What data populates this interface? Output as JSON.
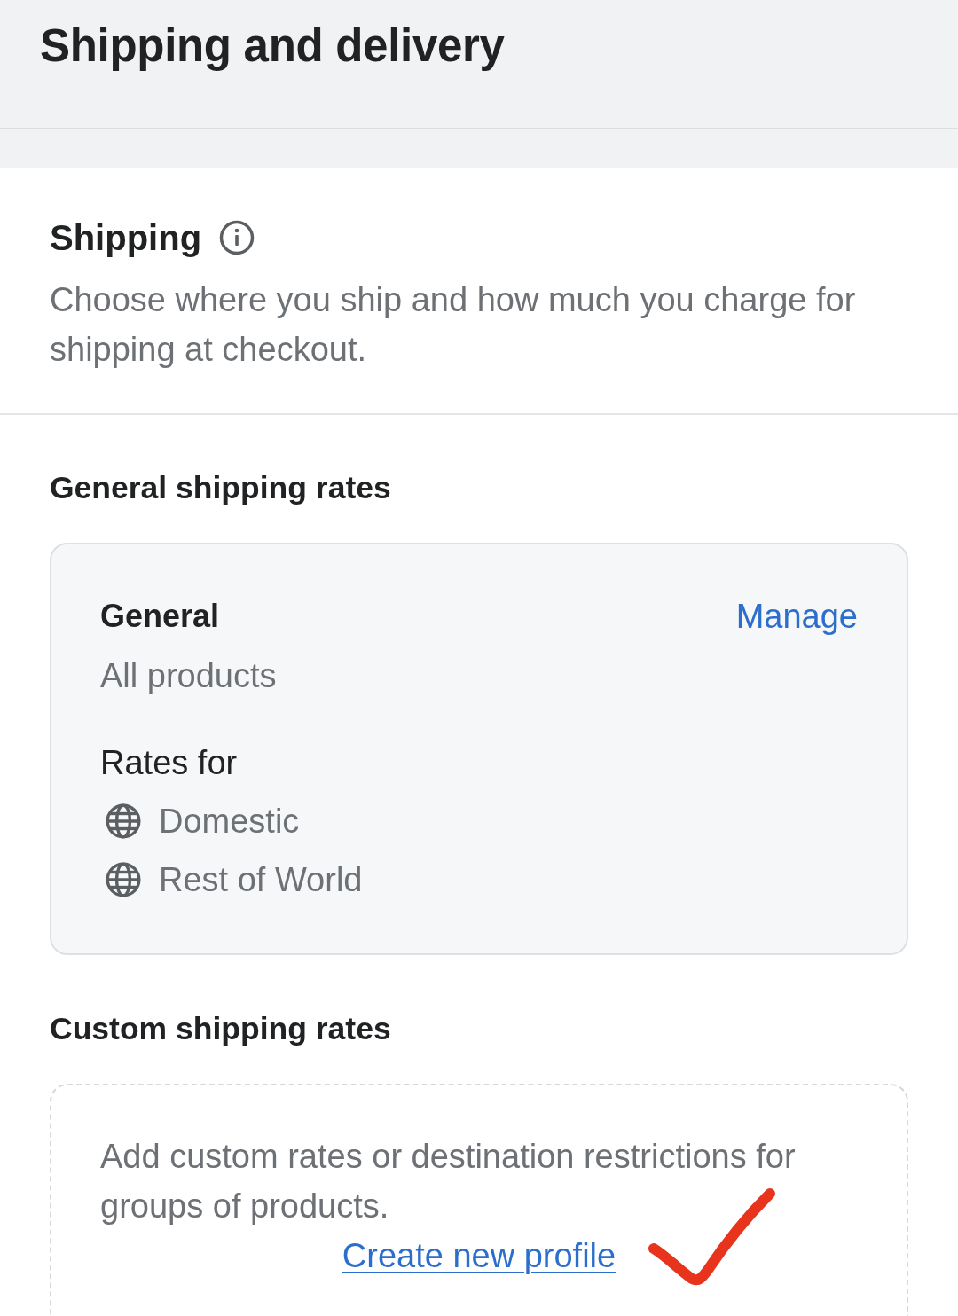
{
  "header": {
    "title": "Shipping and delivery"
  },
  "shipping": {
    "title": "Shipping",
    "description": "Choose where you ship and how much you charge for shipping at checkout."
  },
  "general_rates": {
    "heading": "General shipping rates",
    "profile": {
      "name": "General",
      "action": "Manage",
      "scope": "All products",
      "rates_label": "Rates for",
      "zones": [
        {
          "name": "Domestic"
        },
        {
          "name": "Rest of World"
        }
      ]
    }
  },
  "custom_rates": {
    "heading": "Custom shipping rates",
    "description": "Add custom rates or destination restrictions for groups of products.",
    "link": "Create new profile"
  }
}
